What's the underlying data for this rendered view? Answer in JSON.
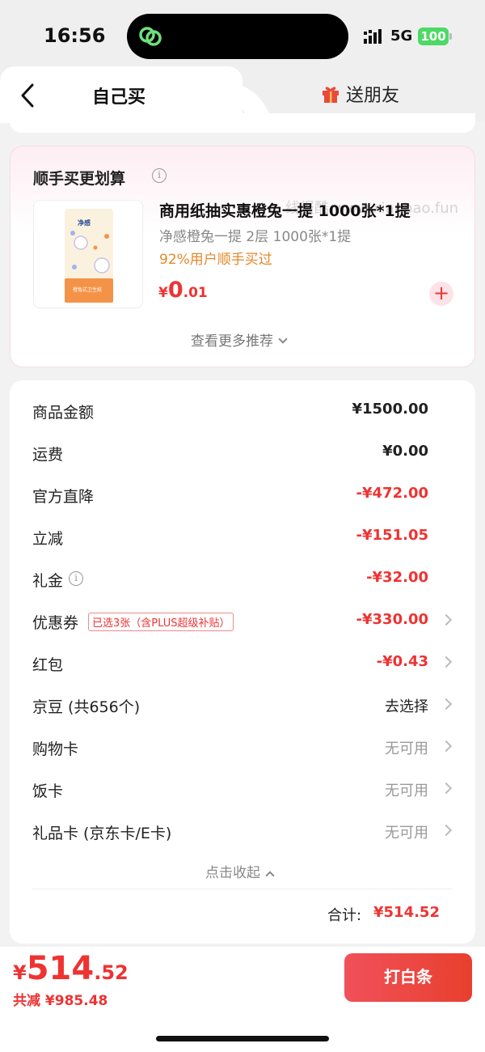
{
  "status": {
    "time": "16:56",
    "network": "5G",
    "battery": "100"
  },
  "tabs": {
    "self_buy": "自己买",
    "gift_friend": "送朋友"
  },
  "recommend": {
    "title": "顺手买更划算",
    "watermark": "线报酷 www.xianbao.fun",
    "product": {
      "name": "商用纸抽实惠橙兔一提 1000张*1提",
      "spec": "净感橙兔一提 2层 1000张*1提",
      "note": "92%用户顺手买过",
      "price_currency": "¥",
      "price_int": "0",
      "price_dec": ".01",
      "package_brand": "净感",
      "package_label": "橙兔式卫生纸"
    },
    "more": "查看更多推荐"
  },
  "summary": {
    "rows": [
      {
        "label": "商品金额",
        "value": "¥1500.00"
      },
      {
        "label": "运费",
        "value": "¥0.00"
      },
      {
        "label": "官方直降",
        "value": "-¥472.00"
      },
      {
        "label": "立减",
        "value": "-¥151.05"
      },
      {
        "label": "礼金",
        "value": "-¥32.00"
      },
      {
        "label": "优惠券",
        "badge": "已选3张（含PLUS超级补贴）",
        "value": "-¥330.00"
      },
      {
        "label": "红包",
        "value": "-¥0.43"
      },
      {
        "label": "京豆 (共656个)",
        "value": "去选择"
      },
      {
        "label": "购物卡",
        "value": "无可用"
      },
      {
        "label": "饭卡",
        "value": "无可用"
      },
      {
        "label": "礼品卡 (京东卡/E卡)",
        "value": "无可用"
      }
    ],
    "collapse": "点击收起",
    "total_label": "合计:",
    "total_value": "¥514.52"
  },
  "bottom": {
    "price_currency": "¥",
    "price_int": "514",
    "price_dec": ".52",
    "saved": "共减 ¥985.48",
    "pay_button": "打白条"
  },
  "colors": {
    "accent_red": "#e33333",
    "pay_gradient_start": "#f0505a",
    "pay_gradient_end": "#e8402e",
    "orange_note": "#e5882a"
  }
}
